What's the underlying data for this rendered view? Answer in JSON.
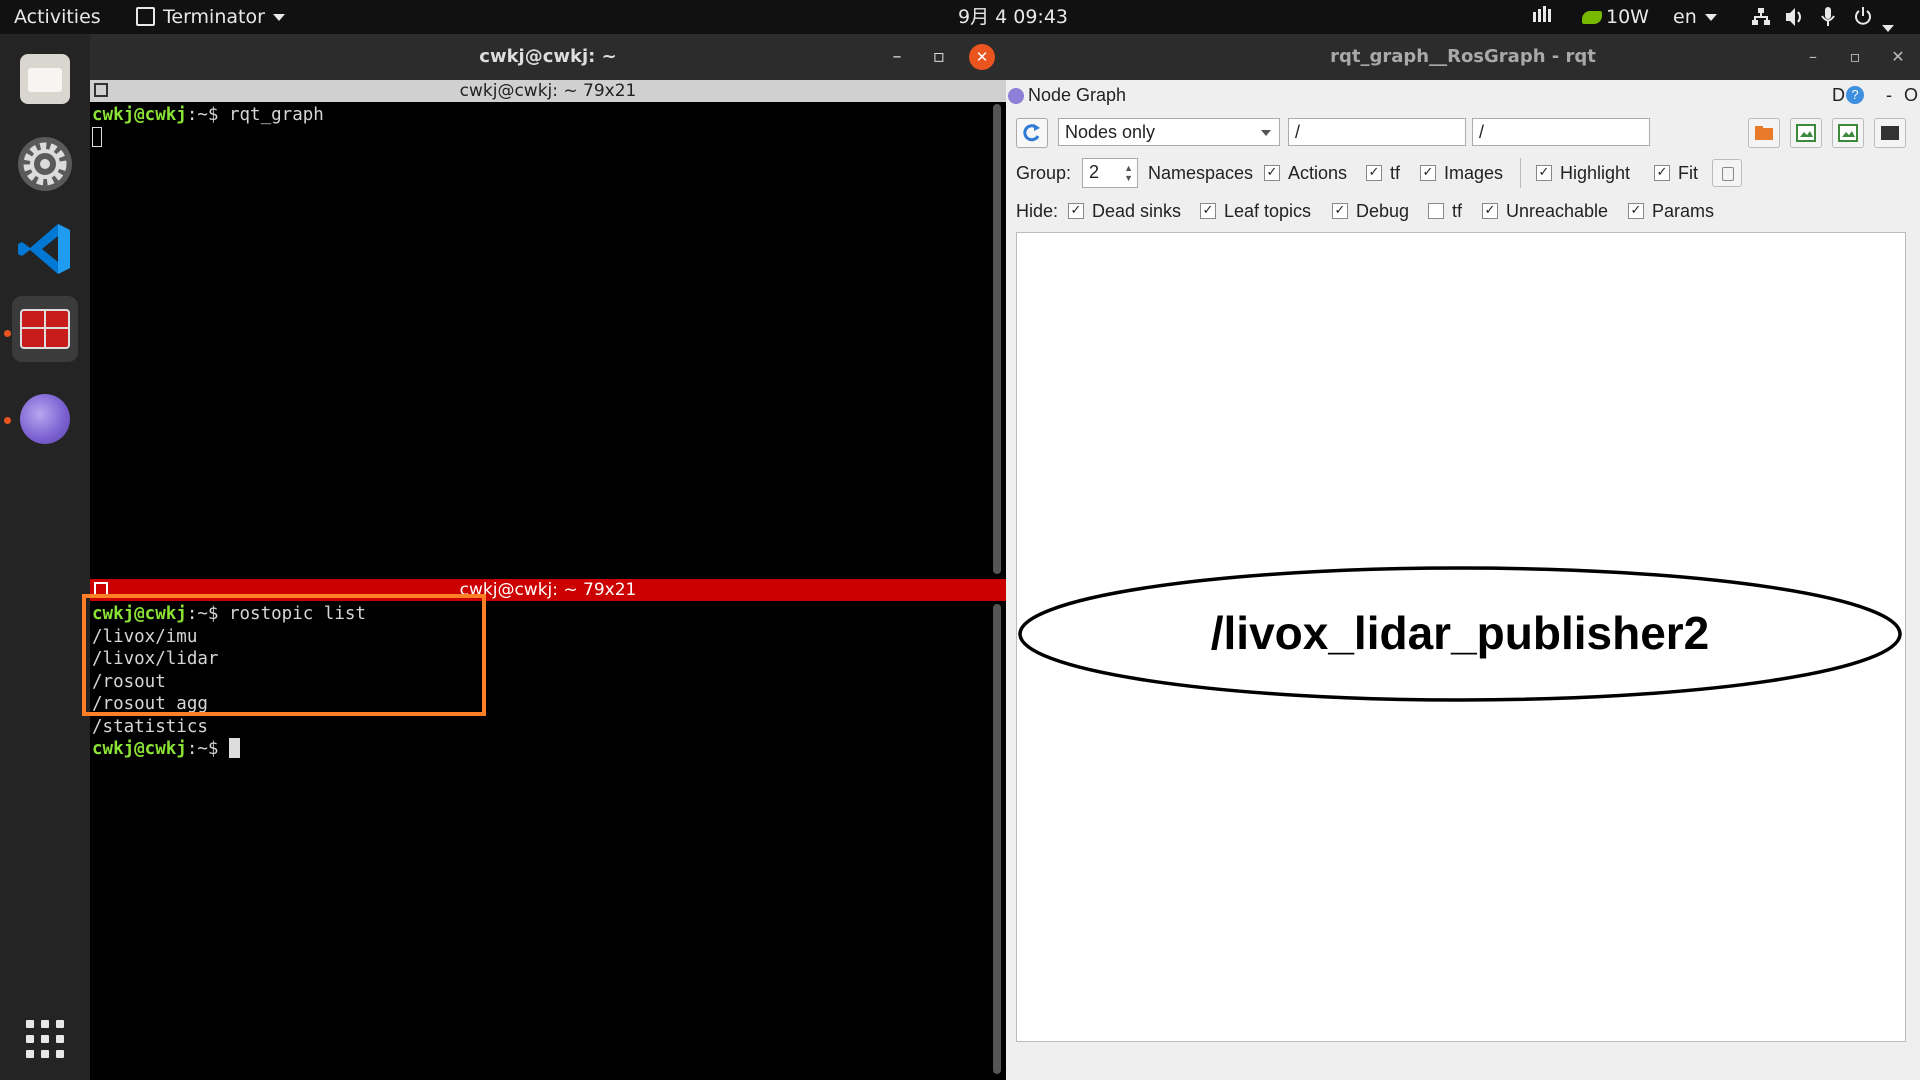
{
  "topbar": {
    "activities": "Activities",
    "app_menu": "Terminator",
    "clock": "9月 4 09:43",
    "gpu_power": "10W",
    "language": "en"
  },
  "dock": {
    "apps": [
      {
        "name": "Files",
        "icon": "files-icon"
      },
      {
        "name": "Settings",
        "icon": "gear-icon"
      },
      {
        "name": "Visual Studio Code",
        "icon": "vscode-icon"
      },
      {
        "name": "Terminator",
        "icon": "terminator-icon",
        "active": true
      },
      {
        "name": "App",
        "icon": "orb-icon"
      }
    ],
    "show_apps": "grid-icon"
  },
  "terminal": {
    "window_title": "cwkj@cwkj: ~",
    "pane_top": {
      "title": "cwkj@cwkj: ~ 79x21",
      "prompt": "cwkj@cwkj",
      "prompt_suffix": ":~$ ",
      "command": "rqt_graph"
    },
    "pane_bottom": {
      "title": "cwkj@cwkj: ~ 79x21",
      "prompt": "cwkj@cwkj",
      "prompt_suffix": ":~$ ",
      "command": "rostopic list",
      "output": [
        "/livox/imu",
        "/livox/lidar",
        "/rosout",
        "/rosout_agg",
        "/statistics"
      ]
    }
  },
  "rqt": {
    "window_title": "rqt_graph__RosGraph - rqt",
    "plugin_title": "Node Graph",
    "plugin_right_d": "D",
    "plugin_right_help": "?",
    "plugin_right_min": "-",
    "plugin_right_o": "O",
    "mode_select": "Nodes only",
    "filter_1": "/",
    "filter_2": "/",
    "group_label": "Group:",
    "group_value": "2",
    "options": [
      {
        "label": "Namespaces",
        "checked": true
      },
      {
        "label": "Actions",
        "checked": true
      },
      {
        "label": "tf",
        "checked": true
      },
      {
        "label": "Images",
        "checked": true
      },
      {
        "label": "Highlight",
        "checked": true
      },
      {
        "label": "Fit",
        "checked": true
      }
    ],
    "hide_label": "Hide:",
    "hide_options": [
      {
        "label": "Dead sinks",
        "checked": true
      },
      {
        "label": "Leaf topics",
        "checked": true
      },
      {
        "label": "Debug",
        "checked": true
      },
      {
        "label": "tf",
        "checked": false
      },
      {
        "label": "Unreachable",
        "checked": true
      },
      {
        "label": "Params",
        "checked": true
      }
    ],
    "graph_node": "/livox_lidar_publisher2",
    "checkmark": "✓"
  },
  "colors": {
    "accent": "#e9541f",
    "prompt_green": "#8ae234",
    "active_pane": "#cc0000",
    "highlight_box": "#ff7f27"
  }
}
